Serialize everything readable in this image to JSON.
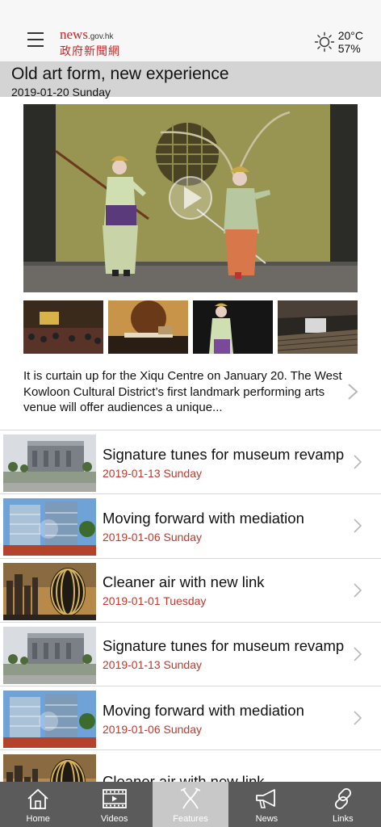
{
  "header": {
    "logo_news": "news",
    "logo_domain": ".gov.hk",
    "logo_chinese": "政府新聞網",
    "temperature": "20°C",
    "humidity": "57%"
  },
  "feature": {
    "title": "Old art form, new experience",
    "date": "2019-01-20 Sunday",
    "summary": "It is curtain up for the Xiqu Centre on January 20. The West Kowloon Cultural District’s first landmark performing arts venue will offer audiences a unique..."
  },
  "list": [
    {
      "title": "Signature tunes for museum revamp",
      "date": "2019-01-13 Sunday"
    },
    {
      "title": "Moving forward with mediation",
      "date": "2019-01-06 Sunday"
    },
    {
      "title": "Cleaner air with new link",
      "date": "2019-01-01 Tuesday"
    },
    {
      "title": "Signature tunes for museum revamp",
      "date": "2019-01-13 Sunday"
    },
    {
      "title": "Moving forward with mediation",
      "date": "2019-01-06 Sunday"
    },
    {
      "title": "Cleaner air with new link",
      "date": ""
    }
  ],
  "tabs": [
    {
      "label": "Home",
      "icon": "home-icon"
    },
    {
      "label": "Videos",
      "icon": "film-icon"
    },
    {
      "label": "Features",
      "icon": "scissors-icon"
    },
    {
      "label": "News",
      "icon": "megaphone-icon"
    },
    {
      "label": "Links",
      "icon": "link-icon"
    }
  ],
  "colors": {
    "accent_red": "#c0392b",
    "tabbar": "#5b5b5b",
    "tab_active": "#c8c8c8",
    "title_bar": "#d4d4d4"
  }
}
